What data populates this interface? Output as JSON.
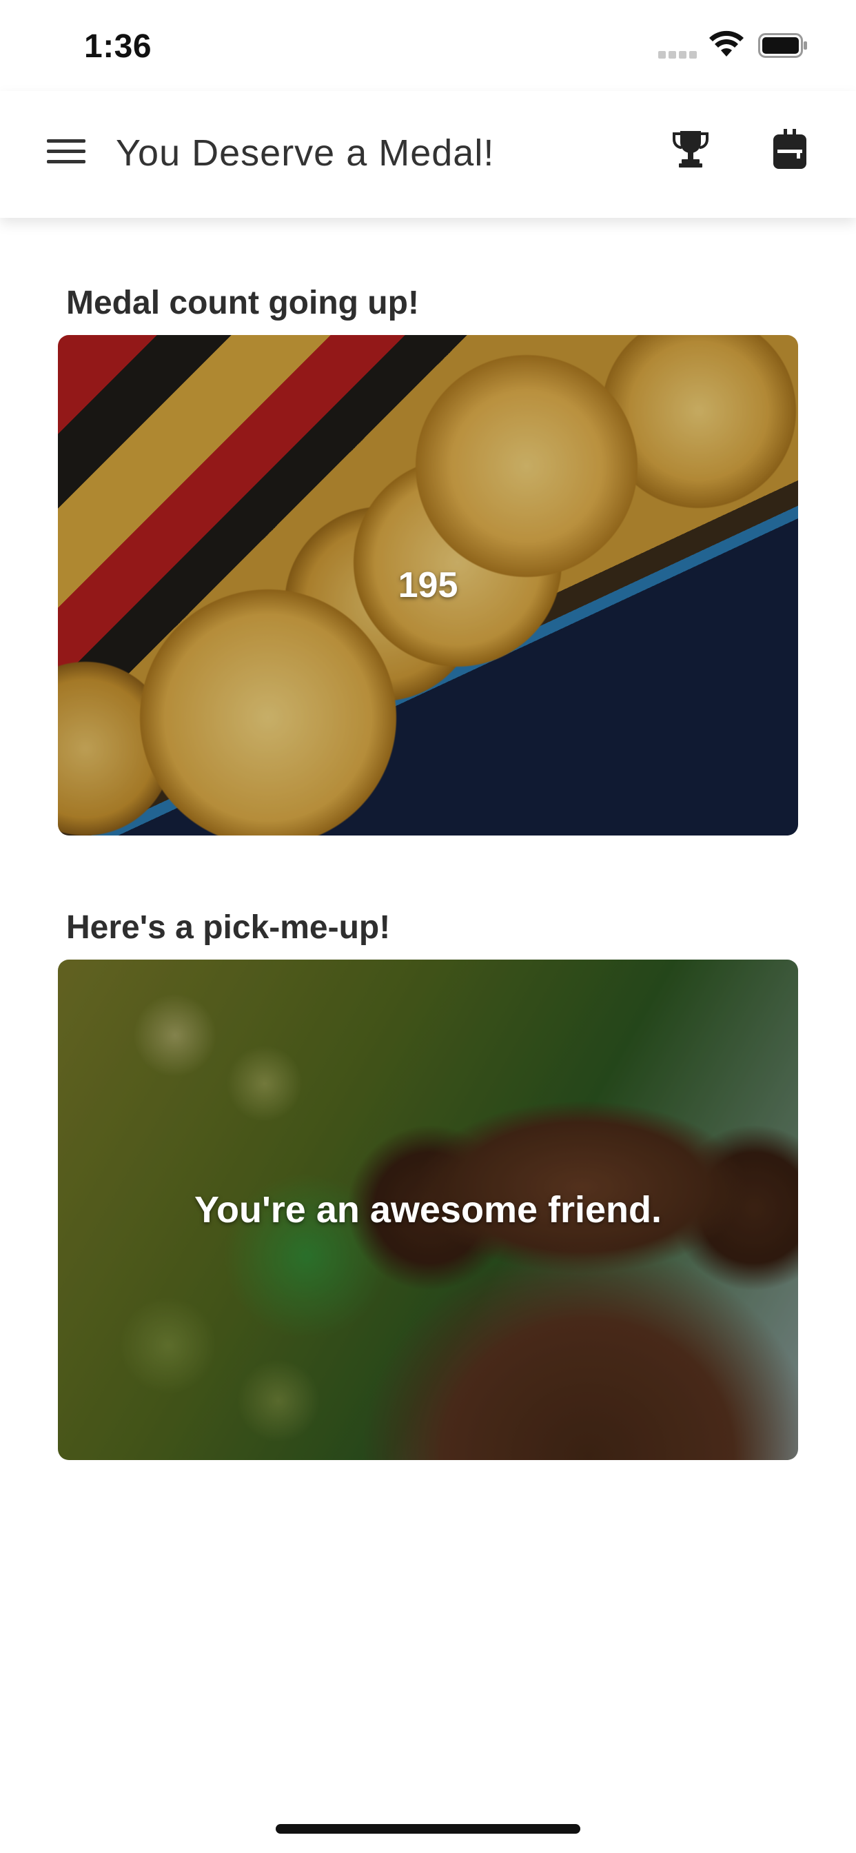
{
  "status_bar": {
    "time": "1:36"
  },
  "app_bar": {
    "title": "You Deserve a Medal!",
    "icons": {
      "menu": "hamburger-menu-icon",
      "trophy": "trophy-icon",
      "backpack": "backpack-icon"
    }
  },
  "sections": {
    "medals": {
      "title": "Medal count going up!",
      "count": "195"
    },
    "pickme": {
      "title": "Here's a pick-me-up!",
      "message": "You're an awesome friend."
    }
  },
  "colors": {
    "text_primary": "#2e2e2e",
    "app_bar_bg": "#ffffff",
    "overlay_text": "#ffffff"
  }
}
